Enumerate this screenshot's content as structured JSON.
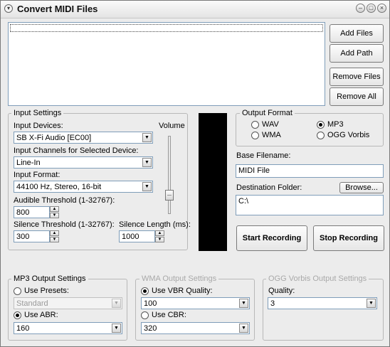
{
  "window": {
    "title": "Convert MIDI Files",
    "title_icon": "chevron-down-icon",
    "controls": [
      "minimize-icon",
      "maximize-icon",
      "close-icon"
    ]
  },
  "file_list": {
    "items": [
      ""
    ]
  },
  "buttons": {
    "add_files": "Add Files",
    "add_path": "Add Path",
    "remove_files": "Remove Files",
    "remove_all": "Remove All",
    "browse": "Browse...",
    "start_recording": "Start Recording",
    "stop_recording": "Stop Recording"
  },
  "input_settings": {
    "legend": "Input Settings",
    "devices_label": "Input Devices:",
    "device_value": "SB X-Fi Audio [EC00]",
    "volume_label": "Volume",
    "volume_level": 0.2,
    "channels_label": "Input Channels for Selected Device:",
    "channel_value": "Line-In",
    "format_label": "Input Format:",
    "format_value": "44100 Hz, Stereo, 16-bit",
    "audible_label": "Audible Threshold (1-32767):",
    "audible_value": "800",
    "silence_threshold_label": "Silence Threshold (1-32767):",
    "silence_threshold_value": "300",
    "silence_length_label": "Silence Length (ms):",
    "silence_length_value": "1000"
  },
  "output_format": {
    "legend": "Output Format",
    "options": [
      "WAV",
      "MP3",
      "WMA",
      "OGG Vorbis"
    ],
    "selected": "MP3"
  },
  "base_filename": {
    "label": "Base Filename:",
    "value": "MIDI File"
  },
  "destination": {
    "label": "Destination Folder:",
    "value": "C:\\"
  },
  "mp3_settings": {
    "legend": "MP3 Output Settings",
    "use_presets_label": "Use Presets:",
    "presets_value": "Standard",
    "use_abr_label": "Use ABR:",
    "abr_value": "160",
    "selected": "Use ABR"
  },
  "wma_settings": {
    "legend": "WMA Output Settings",
    "use_vbr_label": "Use VBR Quality:",
    "vbr_value": "100",
    "use_cbr_label": "Use CBR:",
    "cbr_value": "320",
    "selected": "Use VBR Quality"
  },
  "ogg_settings": {
    "legend": "OGG Vorbis Output Settings",
    "quality_label": "Quality:",
    "quality_value": "3"
  }
}
